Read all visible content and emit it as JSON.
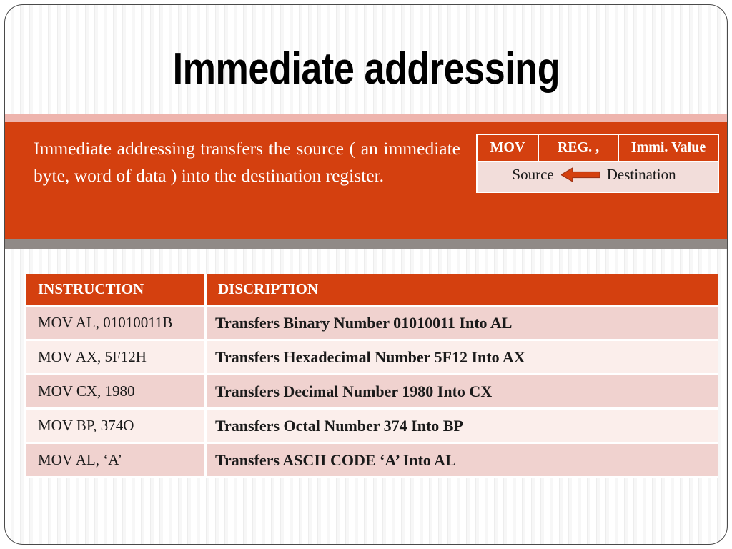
{
  "slide": {
    "title": "Immediate addressing",
    "banner": {
      "body_text": "Immediate addressing transfers the source ( an immediate byte, word of data ) into the destination register.",
      "mov_table": {
        "header": [
          "MOV",
          "REG. ,",
          "Immi. Value"
        ],
        "source_label": "Source",
        "destination_label": "Destination",
        "arrow_icon": "left-arrow-icon"
      }
    },
    "data_table": {
      "headers": [
        "INSTRUCTION",
        "DISCRIPTION"
      ],
      "rows": [
        {
          "instruction": "MOV AL, 01010011B",
          "description": "Transfers Binary Number 01010011 Into AL"
        },
        {
          "instruction": "MOV AX, 5F12H",
          "description": "Transfers Hexadecimal Number 5F12 Into AX"
        },
        {
          "instruction": "MOV CX, 1980",
          "description": "Transfers Decimal Number 1980 Into CX"
        },
        {
          "instruction": "MOV BP, 374O",
          "description": "Transfers Octal Number 374 Into BP"
        },
        {
          "instruction": "MOV AL, ‘A’",
          "description": "Transfers ASCII CODE  ‘A’ Into AL"
        }
      ]
    }
  },
  "colors": {
    "accent_orange": "#d4400f",
    "banner_pink": "#eeb4ad",
    "banner_gray": "#908a87",
    "row_dark": "#f0d2cf",
    "row_light": "#fbeeeb",
    "text_white": "#ffffff"
  }
}
